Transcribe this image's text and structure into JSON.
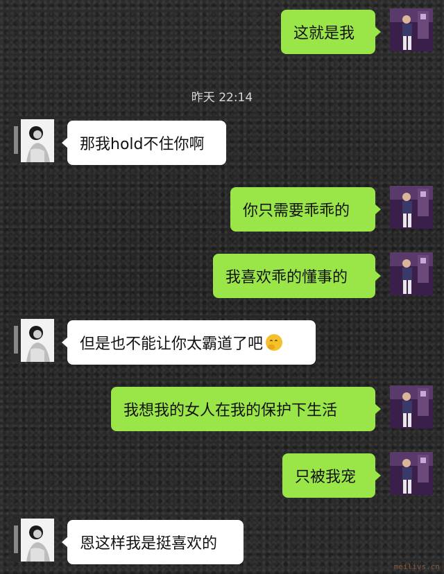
{
  "timestamp": "昨天 22:14",
  "messages": [
    {
      "side": "sent",
      "text": "这就是我"
    },
    {
      "side": "recv",
      "text": "那我hold不住你啊"
    },
    {
      "side": "sent",
      "text": "你只需要乖乖的"
    },
    {
      "side": "sent",
      "text": "我喜欢乖的懂事的"
    },
    {
      "side": "recv",
      "text": "但是也不能让你太霸道了吧",
      "emoji": "thinking-emoji"
    },
    {
      "side": "sent",
      "text": "我想我的女人在我的保护下生活"
    },
    {
      "side": "sent",
      "text": "只被我宠"
    },
    {
      "side": "recv",
      "text": "恩这样我是挺喜欢的"
    }
  ],
  "colors": {
    "sent_bubble": "#9ae649",
    "recv_bubble": "#ffffff",
    "background": "#2a2a2a"
  },
  "watermark": "meilivs.cn"
}
